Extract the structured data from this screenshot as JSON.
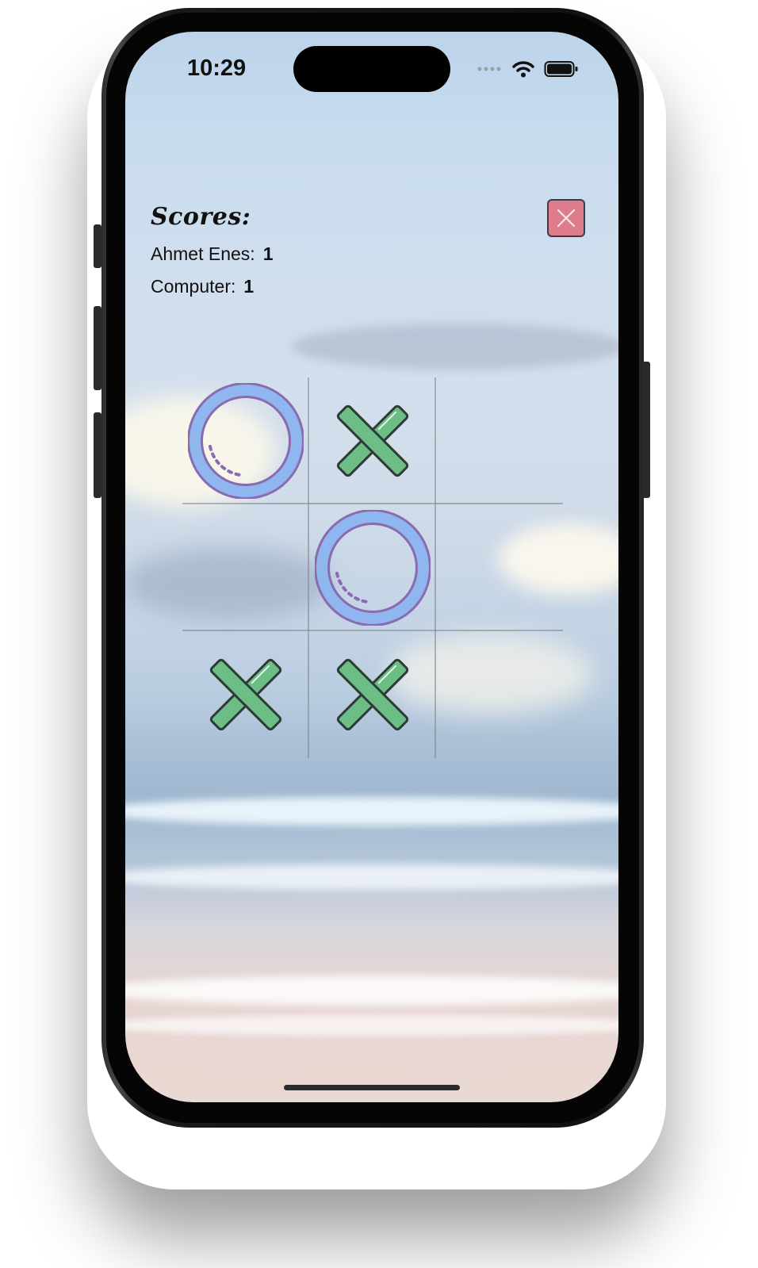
{
  "status_bar": {
    "time": "10:29"
  },
  "scores": {
    "title": "Scores:",
    "players": [
      {
        "name": "Ahmet Enes:",
        "score": "1"
      },
      {
        "name": "Computer:",
        "score": "1"
      }
    ]
  },
  "close_button": {
    "icon": "close-icon",
    "color": "#df7c8c"
  },
  "board": {
    "cells": [
      "O",
      "X",
      "",
      "",
      "O",
      "",
      "X",
      "X",
      ""
    ],
    "x_color": "#6cbd86",
    "o_color": "#8fb6ee",
    "o_outline": "#8a6bb0"
  }
}
